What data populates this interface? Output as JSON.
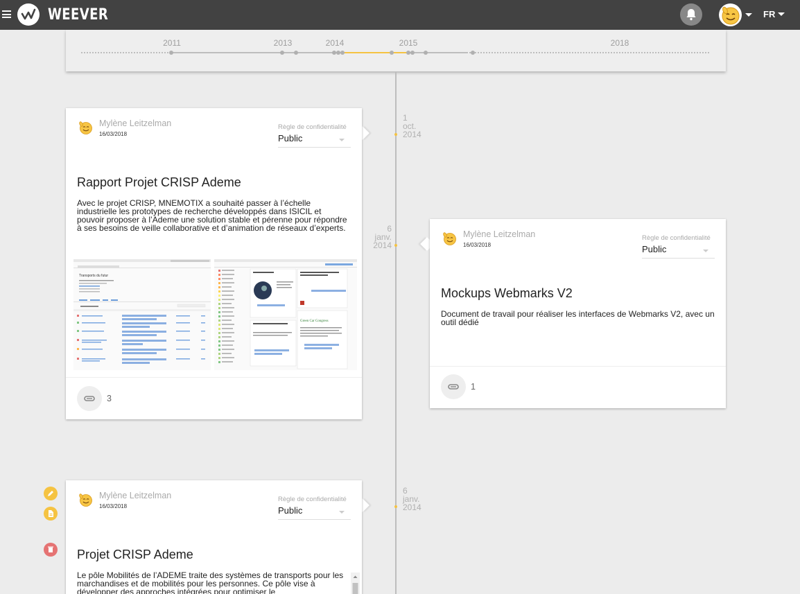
{
  "app": {
    "brand": "WEEVER",
    "language": "FR"
  },
  "timeline": {
    "years": [
      "2011",
      "2013",
      "2014",
      "2015",
      "2018"
    ]
  },
  "entries": [
    {
      "date_day": "1",
      "date_month": "oct.",
      "date_year": "2014",
      "author": "Mylène Leitzelman",
      "published": "16/03/2018",
      "confidentiality_label": "Règle de confidentialité",
      "confidentiality_value": "Public",
      "title": "Rapport Projet CRISP Ademe",
      "description": "Avec le projet CRISP, MNEMOTIX a souhaité passer à l’échelle industrielle les prototypes de recherche développés dans ISICIL et pouvoir proposer à l’Ademe une solution stable et pérenne pour répondre à ses besoins de veille collaborative et d’animation de réseaux d’experts.",
      "attachments": "3"
    },
    {
      "date_day": "6",
      "date_month": "janv.",
      "date_year": "2014",
      "author": "Mylène Leitzelman",
      "published": "16/03/2018",
      "confidentiality_label": "Règle de confidentialité",
      "confidentiality_value": "Public",
      "title": "Mockups Webmarks V2",
      "description": "Document de travail pour réaliser les interfaces de Webmarks V2, avec un outil dédié",
      "attachments": "1"
    },
    {
      "date_day": "6",
      "date_month": "janv.",
      "date_year": "2014",
      "author": "Mylène Leitzelman",
      "published": "16/03/2018",
      "confidentiality_label": "Règle de confidentialité",
      "confidentiality_value": "Public",
      "title": "Projet CRISP Ademe",
      "description": "Le pôle Mobilités de l’ADEME traite des systèmes de transports pour les marchandises et de mobilités pour les personnes. Ce pôle vise à développer des approches intégrées pour optimiser le"
    }
  ],
  "thumbnails": {
    "left_title": "Transports du futur",
    "right_title": "Green Car Congress"
  },
  "colors": {
    "topbar": "#424242",
    "accent": "#f5c342",
    "edit": "#f5c342",
    "delete": "#e57373"
  }
}
